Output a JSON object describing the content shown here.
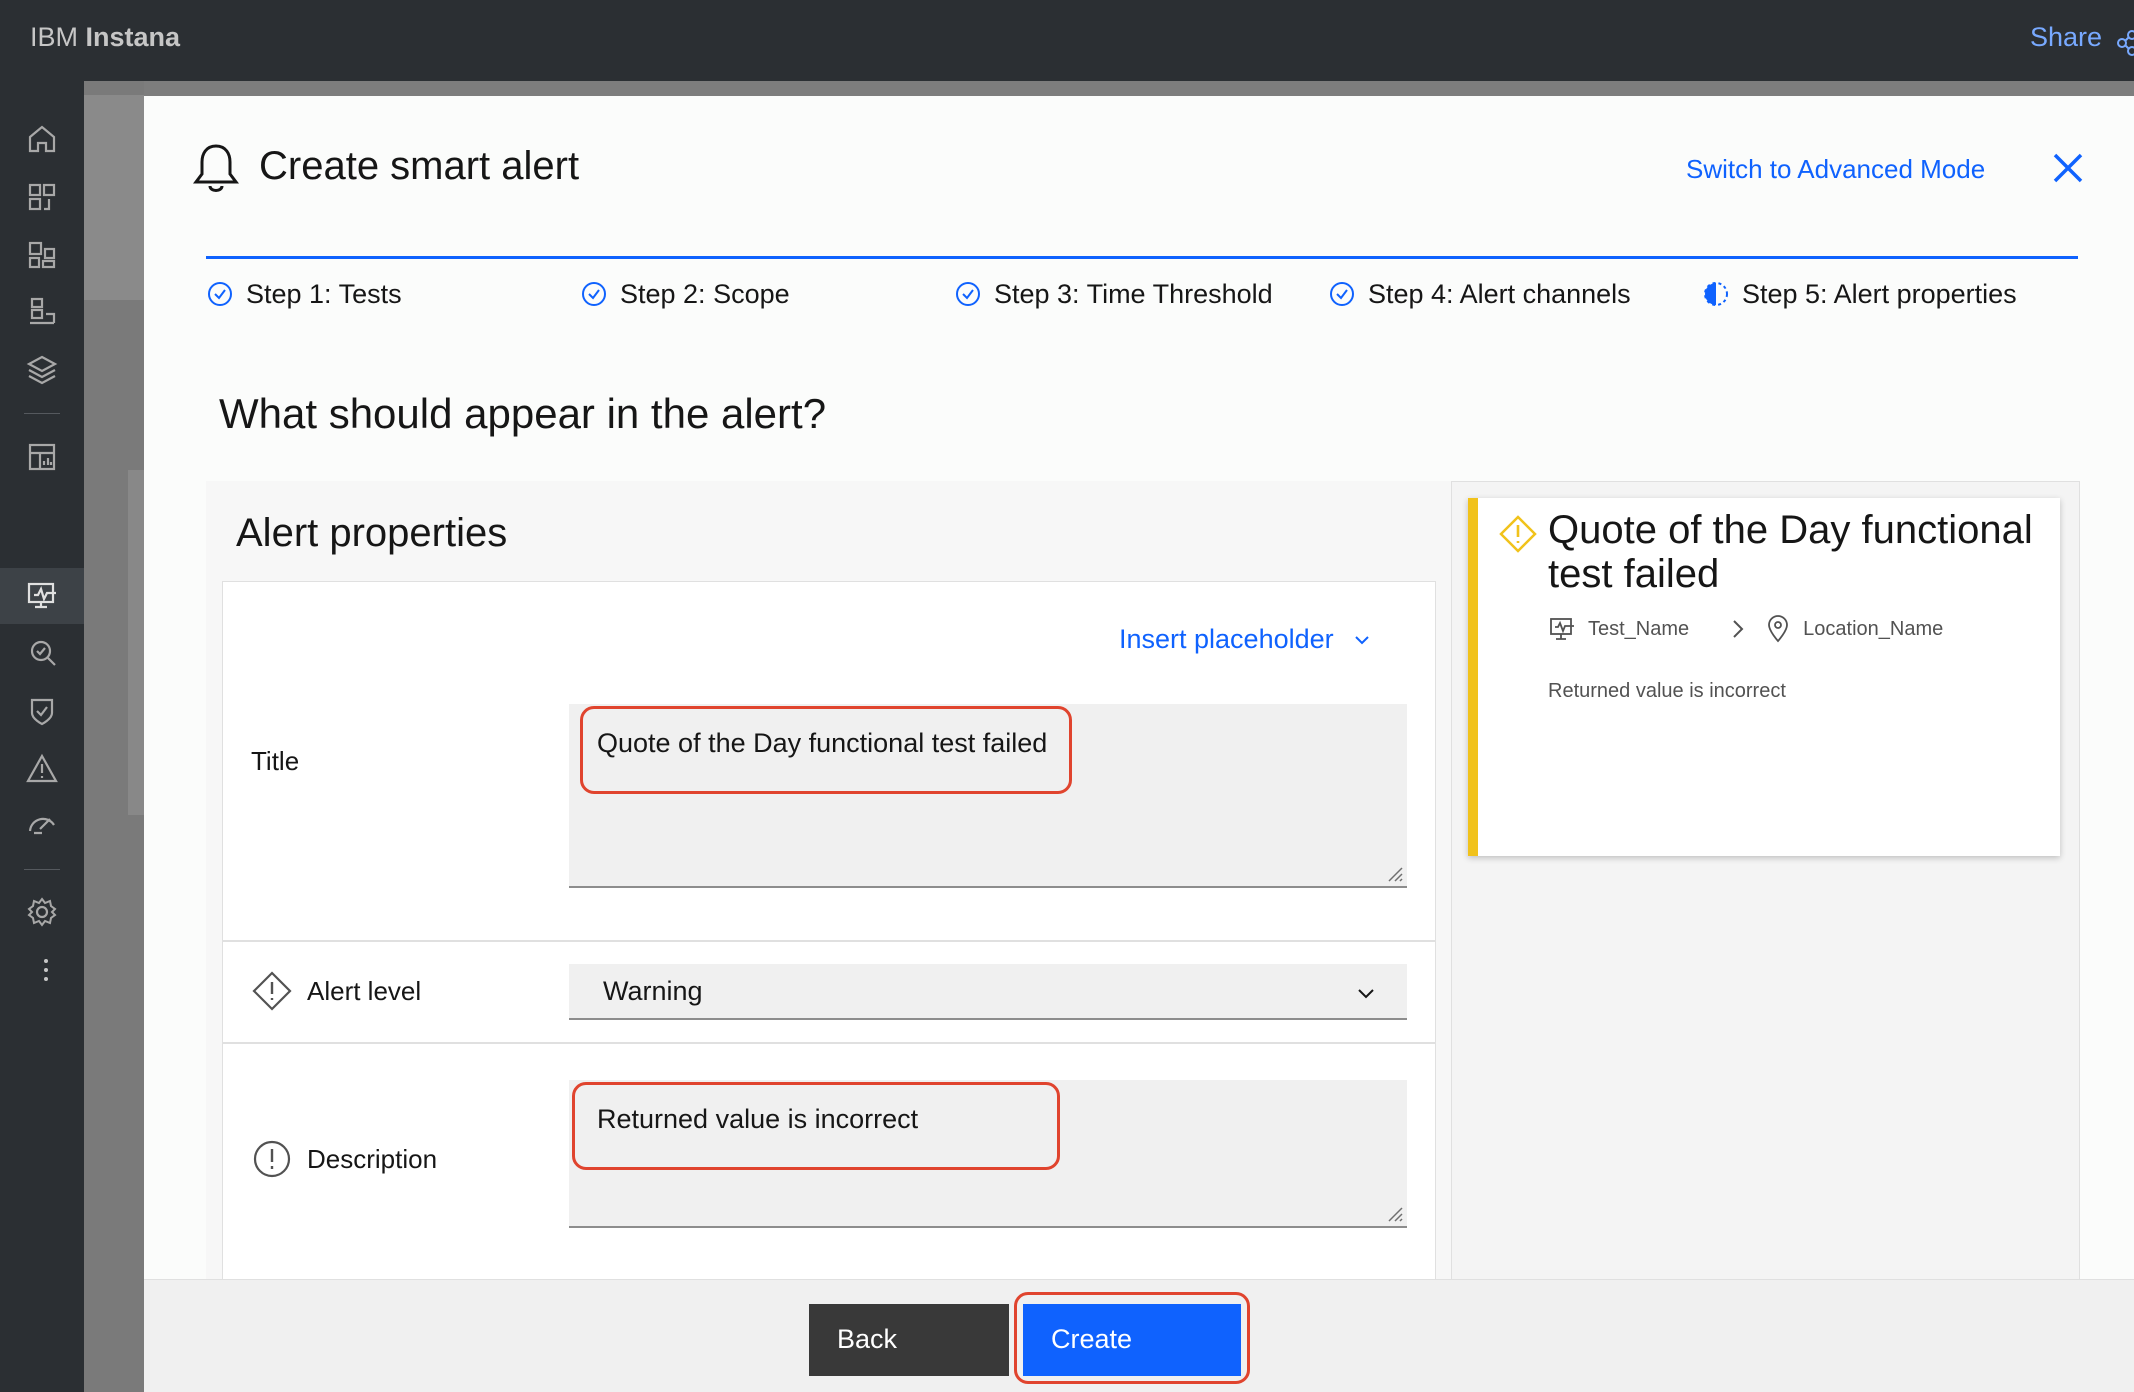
{
  "header": {
    "brand_prefix": "IBM",
    "brand_name": "Instana",
    "share_label": "Share"
  },
  "nav": {
    "items": [
      "home-icon",
      "application-topology-icon",
      "services-icon",
      "infrastructure-icon",
      "stack-icon",
      "dashboard-icon",
      "synthetic-monitoring-icon",
      "analytics-icon",
      "security-icon",
      "events-icon",
      "performance-icon",
      "settings-icon",
      "more-icon"
    ],
    "active_item": "synthetic-monitoring-icon"
  },
  "modal": {
    "title": "Create smart alert",
    "switch_mode_label": "Switch to Advanced Mode",
    "steps": [
      {
        "label": "Step 1: Tests",
        "status": "complete"
      },
      {
        "label": "Step 2: Scope",
        "status": "complete"
      },
      {
        "label": "Step 3: Time Threshold",
        "status": "complete"
      },
      {
        "label": "Step 4: Alert channels",
        "status": "complete"
      },
      {
        "label": "Step 5: Alert properties",
        "status": "current"
      }
    ],
    "question": "What should appear in the alert?",
    "panel_heading": "Alert properties",
    "insert_placeholder_label": "Insert placeholder",
    "fields": {
      "title_label": "Title",
      "title_value": "Quote of the Day functional test failed",
      "alert_level_label": "Alert level",
      "alert_level_value": "Warning",
      "description_label": "Description",
      "description_value": "Returned value is incorrect"
    },
    "preview": {
      "title": "Quote of the Day functional test failed",
      "test_name": "Test_Name",
      "location_name": "Location_Name",
      "description": "Returned value is incorrect",
      "accent_color": "#f1c21b"
    },
    "footer": {
      "back_label": "Back",
      "create_label": "Create"
    }
  },
  "colors": {
    "primary": "#0f62fe",
    "highlight": "#e0442e",
    "warning": "#f1c21b"
  }
}
